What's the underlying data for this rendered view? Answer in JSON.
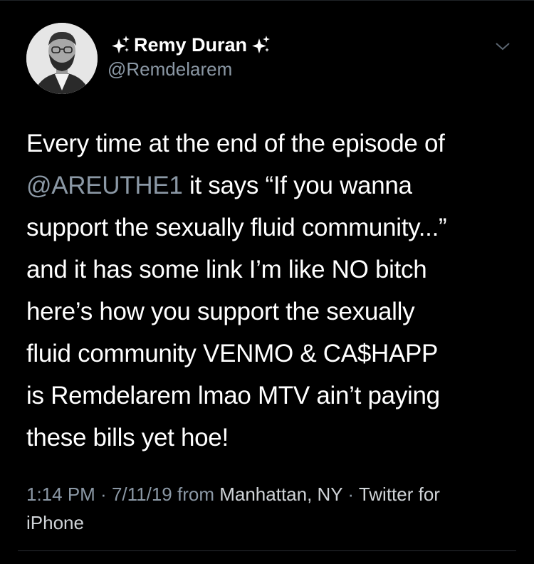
{
  "tweet": {
    "author": {
      "name": "Remy Duran",
      "handle": "@Remdelarem"
    },
    "text_lines": [
      {
        "before": "Every time at the end of the episode of",
        "mention": "",
        "after": ""
      },
      {
        "before": "",
        "mention": "@AREUTHE1",
        "after": " it says “If you wanna"
      },
      {
        "before": "support the sexually fluid community...”",
        "mention": "",
        "after": ""
      },
      {
        "before": "and it has some link I’m like NO bitch",
        "mention": "",
        "after": ""
      },
      {
        "before": "here’s how you support the sexually",
        "mention": "",
        "after": ""
      },
      {
        "before": "fluid community VENMO & CA$HAPP",
        "mention": "",
        "after": ""
      },
      {
        "before": "is Remdelarem lmao MTV ain’t paying",
        "mention": "",
        "after": ""
      },
      {
        "before": "these bills yet hoe!",
        "mention": "",
        "after": ""
      }
    ],
    "meta": {
      "time": "1:14 PM",
      "separator": " · ",
      "date": "7/11/19",
      "from_word": " from ",
      "location": "Manhattan, NY",
      "client_line1": "Twitter for",
      "client_line2": "iPhone"
    }
  },
  "icons": {
    "sparkle": "sparkles-icon",
    "chevron": "chevron-down-icon",
    "avatar": "avatar"
  },
  "colors": {
    "background": "#000000",
    "text": "#ffffff",
    "secondary": "#8b98a5"
  }
}
